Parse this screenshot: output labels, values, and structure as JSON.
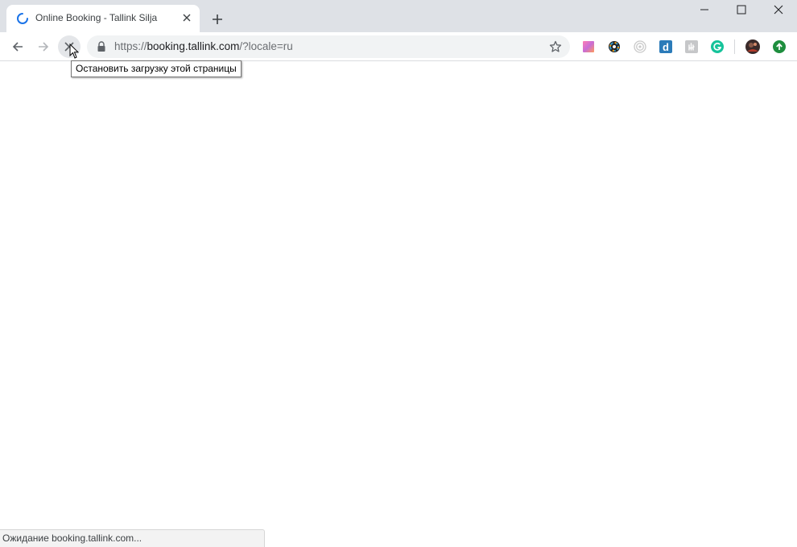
{
  "tab": {
    "title": "Online Booking - Tallink Silja",
    "loading": true
  },
  "omnibox": {
    "url_scheme": "https://",
    "url_host": "booking.tallink.com",
    "url_path": "/?locale=ru"
  },
  "tooltip": {
    "text": "Остановить загрузку этой страницы"
  },
  "status": {
    "text": "Ожидание booking.tallink.com..."
  },
  "icons": {
    "back": "back-arrow-icon",
    "forward": "forward-arrow-icon",
    "stop": "stop-icon",
    "lock": "lock-icon",
    "bookmark": "star-icon",
    "extensions": [
      "gradient-square-icon",
      "color-wheel-icon",
      "spiral-icon",
      "letter-d-icon",
      "hand-icon",
      "grammarly-icon"
    ],
    "profile": "avatar-icon",
    "update": "update-arrow-icon"
  },
  "colors": {
    "tabstrip": "#dee1e6",
    "omnibox": "#f1f3f4",
    "spinner": "#1a73e8",
    "grammarly": "#15c39a",
    "update": "#1e8e3e",
    "ext_d": "#2b7bb9"
  }
}
